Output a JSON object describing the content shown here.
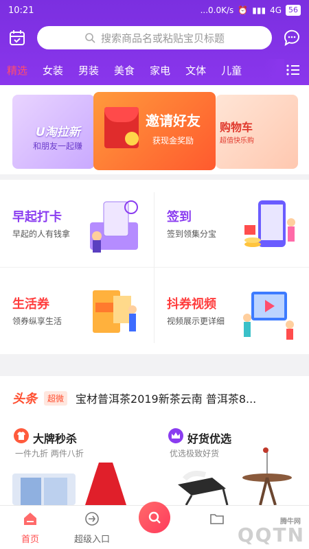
{
  "status_bar": {
    "time": "10:21",
    "net": "...0.0K/s",
    "signal": "4G",
    "battery": "56"
  },
  "search": {
    "placeholder": "搜索商品名或粘贴宝贝标题"
  },
  "tabs": [
    "精选",
    "女装",
    "男装",
    "美食",
    "家电",
    "文体",
    "儿童"
  ],
  "active_tab_color": "#ff4d6d",
  "banners": {
    "left": {
      "title": "U淘拉新",
      "subtitle": "和朋友一起赚"
    },
    "center": {
      "title": "邀请好友",
      "subtitle": "获现金奖励"
    },
    "right": {
      "title": "购物车",
      "subtitle": "超值快乐购"
    }
  },
  "features": [
    {
      "title": "早起打卡",
      "subtitle": "早起的人有钱拿",
      "color": "#8a3cf0"
    },
    {
      "title": "签到",
      "subtitle": "签到领集分宝",
      "color": "#8a3cf0"
    },
    {
      "title": "生活券",
      "subtitle": "领券纵享生活",
      "color": "#ff3d3d"
    },
    {
      "title": "抖券视频",
      "subtitle": "视频展示更详细",
      "color": "#ff3d3d"
    }
  ],
  "headline": {
    "logo": "头条",
    "tag": "超微",
    "text": "宝材普洱茶2019新茶云南 普洱茶8..."
  },
  "promo": [
    {
      "title": "大牌秒杀",
      "subtitle": "一件九折    两件八折"
    },
    {
      "title": "好货优选",
      "subtitle": "优选极致好货"
    }
  ],
  "bottom_nav": [
    {
      "label": "首页",
      "icon": "home-icon"
    },
    {
      "label": "超级入口",
      "icon": "login-arrow-icon"
    },
    {
      "label": "",
      "icon": "search-icon"
    },
    {
      "label": "",
      "icon": "folder-icon"
    }
  ],
  "watermark": {
    "big": "QQTN",
    "small": "腾牛网"
  }
}
